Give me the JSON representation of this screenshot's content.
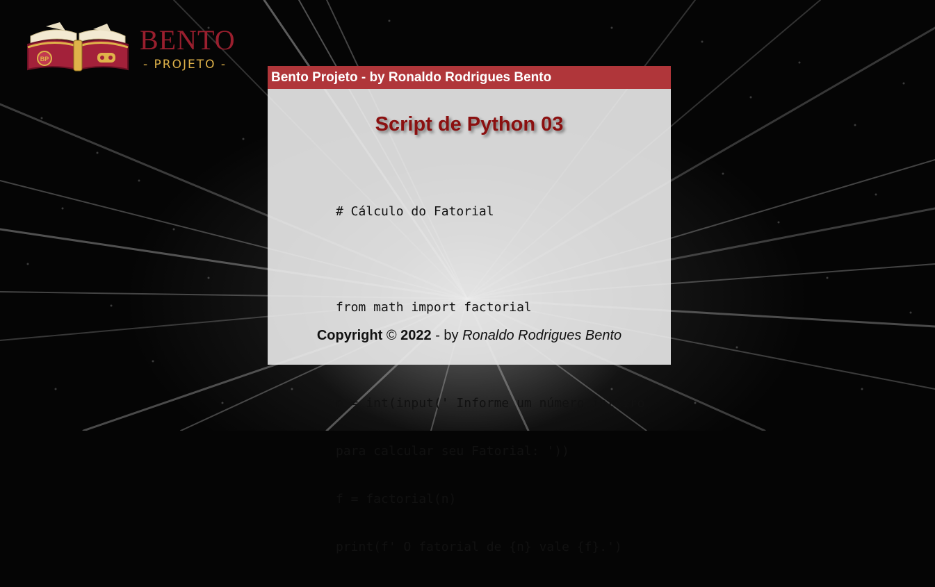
{
  "logo": {
    "wordmark": "BENTO",
    "subtitle": "- PROJETO -",
    "book_icon_labels": [
      "BP"
    ],
    "colors": {
      "brand_red": "#9a1f2e",
      "brand_gold": "#e0b34a"
    }
  },
  "panel": {
    "header": "Bento Projeto - by Ronaldo Rodrigues Bento",
    "title": "Script de Python 03",
    "code_lines": [
      "# Cálculo do Fatorial",
      "",
      "from math import factorial",
      "",
      "n = int(input(' Informe um número inteiro",
      "para calcular seu Fatorial: '))",
      "f = factorial(n)",
      "print(f' O fatorial de {n} vale {f}.')"
    ],
    "footer": {
      "copyright": "Copyright",
      "symbol": "©",
      "year": "2022",
      "by_text": "- by",
      "author": "Ronaldo Rodrigues Bento"
    },
    "colors": {
      "header_bg": "#b0363a",
      "title_color": "#8b1010"
    }
  }
}
